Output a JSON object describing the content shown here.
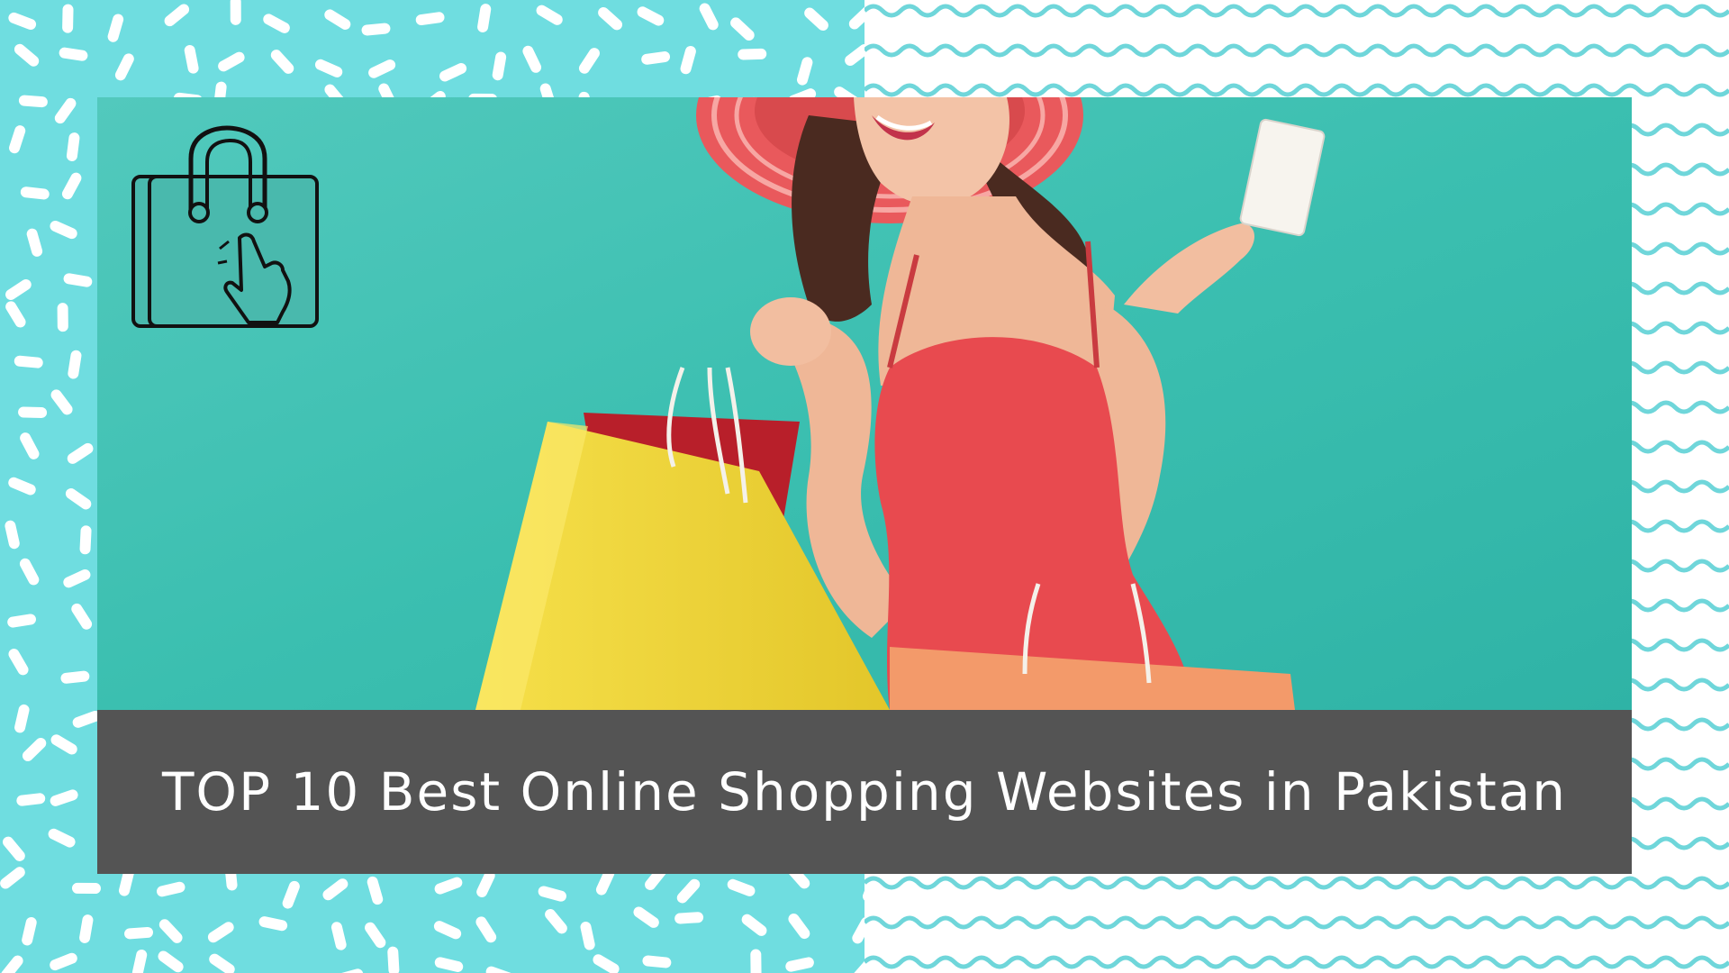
{
  "banner": {
    "title": "TOP 10 Best Online Shopping Websites in Pakistan"
  },
  "colors": {
    "left_background": "#6fdde0",
    "sprinkle": "#ffffff",
    "wave": "#6fd6da",
    "photo_background": "#3fbfb0",
    "title_bar": "#545454",
    "title_text": "#ffffff",
    "dress": "#e84a4f",
    "hat": "#f06a6a",
    "yellow_bag": "#f2d83a",
    "orange_bag": "#f39a6a",
    "red_bag": "#b81f2a"
  },
  "icons": {
    "logo": "shopping-bag-with-pointing-hand-icon"
  },
  "photo": {
    "subject": "woman-in-red-dress-holding-shopping-bags-and-card"
  }
}
